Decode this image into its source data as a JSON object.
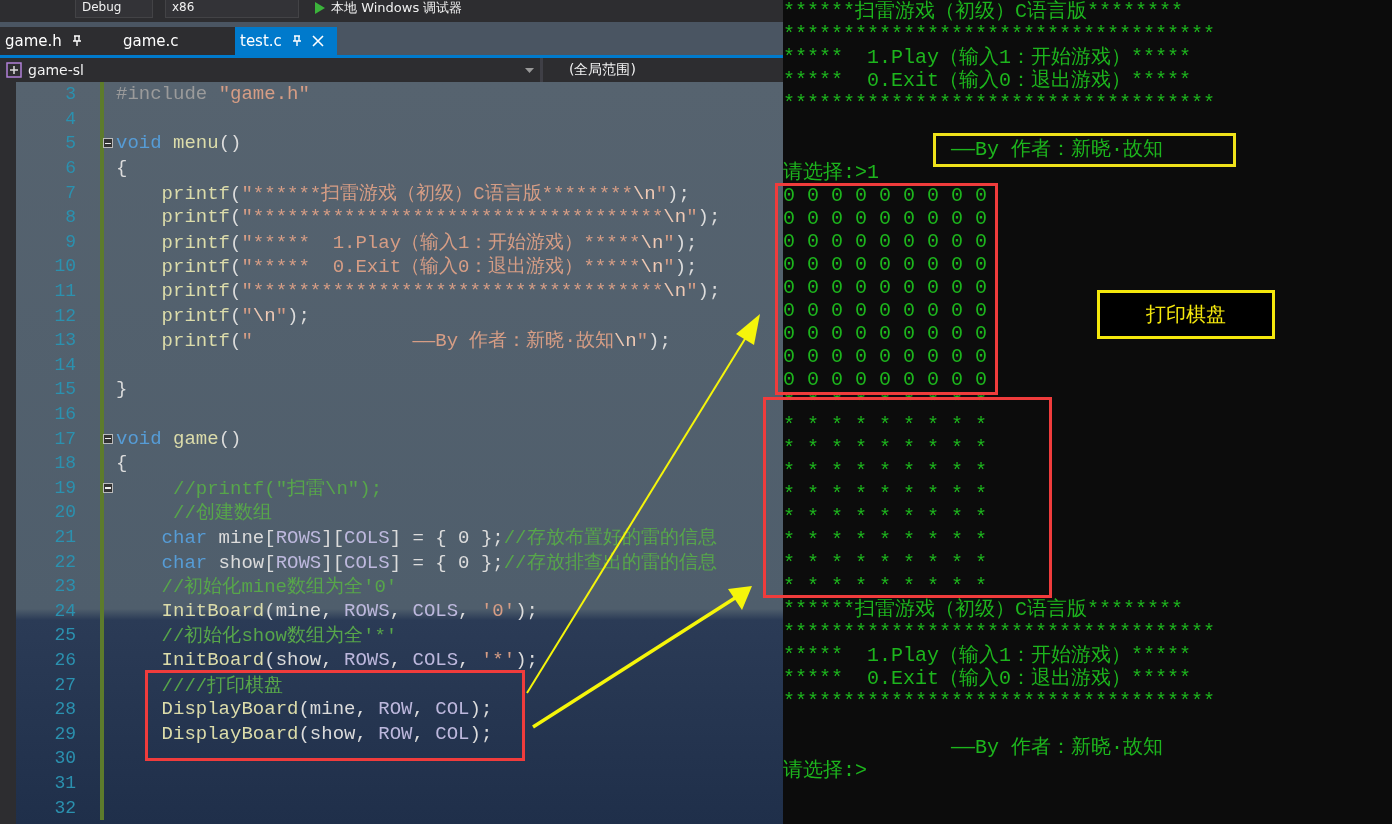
{
  "toolbar": {
    "configuration": "Debug",
    "platform": "x86",
    "debugger": "本地 Windows 调试器"
  },
  "tabs": [
    {
      "label": "game.h",
      "selected": false,
      "pinned": true
    },
    {
      "label": "game.c",
      "selected": false,
      "pinned": false
    },
    {
      "label": "test.c",
      "selected": true,
      "pinned": true
    }
  ],
  "navigation": {
    "project": "game-sl",
    "scope": "(全局范围)"
  },
  "code_lines": [
    {
      "number": "3",
      "fold": false,
      "tokens": [
        {
          "text": "#include ",
          "kind": "pre"
        },
        {
          "text": "\"game.h\"",
          "kind": "str"
        }
      ]
    },
    {
      "number": "4",
      "fold": false
    },
    {
      "number": "5",
      "fold": true,
      "tokens": [
        {
          "text": "void",
          "kind": "kw"
        },
        {
          "text": " menu",
          "kind": "fn"
        },
        {
          "text": "()",
          "kind": "plain"
        }
      ]
    },
    {
      "number": "6",
      "fold": false,
      "tokens": [
        {
          "text": "{",
          "kind": "plain"
        }
      ]
    },
    {
      "number": "7",
      "fold": false,
      "tokens": [
        {
          "text": "    printf",
          "kind": "fn"
        },
        {
          "text": "(",
          "kind": "plain"
        },
        {
          "text": "\"******扫雷游戏（初级）C语言版********",
          "kind": "str"
        },
        {
          "text": "\\n",
          "kind": "esc"
        },
        {
          "text": "\"",
          "kind": "str"
        },
        {
          "text": ");",
          "kind": "plain"
        }
      ]
    },
    {
      "number": "8",
      "fold": false,
      "tokens": [
        {
          "text": "    printf",
          "kind": "fn"
        },
        {
          "text": "(",
          "kind": "plain"
        },
        {
          "text": "\"************************************",
          "kind": "str"
        },
        {
          "text": "\\n",
          "kind": "esc"
        },
        {
          "text": "\"",
          "kind": "str"
        },
        {
          "text": ");",
          "kind": "plain"
        }
      ]
    },
    {
      "number": "9",
      "fold": false,
      "tokens": [
        {
          "text": "    printf",
          "kind": "fn"
        },
        {
          "text": "(",
          "kind": "plain"
        },
        {
          "text": "\"*****  1.Play（输入1：开始游戏）*****",
          "kind": "str"
        },
        {
          "text": "\\n",
          "kind": "esc"
        },
        {
          "text": "\"",
          "kind": "str"
        },
        {
          "text": ");",
          "kind": "plain"
        }
      ]
    },
    {
      "number": "10",
      "fold": false,
      "tokens": [
        {
          "text": "    printf",
          "kind": "fn"
        },
        {
          "text": "(",
          "kind": "plain"
        },
        {
          "text": "\"*****  0.Exit（输入0：退出游戏）*****",
          "kind": "str"
        },
        {
          "text": "\\n",
          "kind": "esc"
        },
        {
          "text": "\"",
          "kind": "str"
        },
        {
          "text": ");",
          "kind": "plain"
        }
      ]
    },
    {
      "number": "11",
      "fold": false,
      "tokens": [
        {
          "text": "    printf",
          "kind": "fn"
        },
        {
          "text": "(",
          "kind": "plain"
        },
        {
          "text": "\"************************************",
          "kind": "str"
        },
        {
          "text": "\\n",
          "kind": "esc"
        },
        {
          "text": "\"",
          "kind": "str"
        },
        {
          "text": ");",
          "kind": "plain"
        }
      ]
    },
    {
      "number": "12",
      "fold": false,
      "tokens": [
        {
          "text": "    printf",
          "kind": "fn"
        },
        {
          "text": "(",
          "kind": "plain"
        },
        {
          "text": "\"",
          "kind": "str"
        },
        {
          "text": "\\n",
          "kind": "esc"
        },
        {
          "text": "\"",
          "kind": "str"
        },
        {
          "text": ");",
          "kind": "plain"
        }
      ]
    },
    {
      "number": "13",
      "fold": false,
      "tokens": [
        {
          "text": "    printf",
          "kind": "fn"
        },
        {
          "text": "(",
          "kind": "plain"
        },
        {
          "text": "\"              ——By 作者：新晓·故知",
          "kind": "str"
        },
        {
          "text": "\\n",
          "kind": "esc"
        },
        {
          "text": "\"",
          "kind": "str"
        },
        {
          "text": ");",
          "kind": "plain"
        }
      ]
    },
    {
      "number": "14",
      "fold": false
    },
    {
      "number": "15",
      "fold": false,
      "tokens": [
        {
          "text": "}",
          "kind": "plain"
        }
      ]
    },
    {
      "number": "16",
      "fold": false
    },
    {
      "number": "17",
      "fold": true,
      "tokens": [
        {
          "text": "void",
          "kind": "kw"
        },
        {
          "text": " game",
          "kind": "fn"
        },
        {
          "text": "()",
          "kind": "plain"
        }
      ]
    },
    {
      "number": "18",
      "fold": false,
      "tokens": [
        {
          "text": "{",
          "kind": "plain"
        }
      ]
    },
    {
      "number": "19",
      "fold": true,
      "tokens": [
        {
          "text": "     //printf(\"扫雷\\n\");",
          "kind": "comment"
        }
      ]
    },
    {
      "number": "20",
      "fold": false,
      "tokens": [
        {
          "text": "     //创建数组",
          "kind": "comment"
        }
      ]
    },
    {
      "number": "21",
      "fold": false,
      "tokens": [
        {
          "text": "    char",
          "kind": "kw"
        },
        {
          "text": " mine[",
          "kind": "plain"
        },
        {
          "text": "ROWS",
          "kind": "macro"
        },
        {
          "text": "][",
          "kind": "plain"
        },
        {
          "text": "COLS",
          "kind": "macro"
        },
        {
          "text": "] = { 0 };",
          "kind": "plain"
        },
        {
          "text": "//存放布置好的雷的信息",
          "kind": "comment"
        }
      ]
    },
    {
      "number": "22",
      "fold": false,
      "tokens": [
        {
          "text": "    char",
          "kind": "kw"
        },
        {
          "text": " show[",
          "kind": "plain"
        },
        {
          "text": "ROWS",
          "kind": "macro"
        },
        {
          "text": "][",
          "kind": "plain"
        },
        {
          "text": "COLS",
          "kind": "macro"
        },
        {
          "text": "] = { 0 };",
          "kind": "plain"
        },
        {
          "text": "//存放排查出的雷的信息",
          "kind": "comment"
        }
      ]
    },
    {
      "number": "23",
      "fold": false,
      "tokens": [
        {
          "text": "    //初始化mine数组为全'0'",
          "kind": "comment"
        }
      ]
    },
    {
      "number": "24",
      "fold": false,
      "tokens": [
        {
          "text": "    InitBoard",
          "kind": "fn"
        },
        {
          "text": "(mine, ",
          "kind": "plain"
        },
        {
          "text": "ROWS",
          "kind": "macro"
        },
        {
          "text": ", ",
          "kind": "plain"
        },
        {
          "text": "COLS",
          "kind": "macro"
        },
        {
          "text": ", ",
          "kind": "plain"
        },
        {
          "text": "'0'",
          "kind": "str"
        },
        {
          "text": ");",
          "kind": "plain"
        }
      ]
    },
    {
      "number": "25",
      "fold": false,
      "tokens": [
        {
          "text": "    //初始化show数组为全'*'",
          "kind": "comment"
        }
      ]
    },
    {
      "number": "26",
      "fold": false,
      "tokens": [
        {
          "text": "    InitBoard",
          "kind": "fn"
        },
        {
          "text": "(show, ",
          "kind": "plain"
        },
        {
          "text": "ROWS",
          "kind": "macro"
        },
        {
          "text": ", ",
          "kind": "plain"
        },
        {
          "text": "COLS",
          "kind": "macro"
        },
        {
          "text": ", ",
          "kind": "plain"
        },
        {
          "text": "'*'",
          "kind": "str"
        },
        {
          "text": ");",
          "kind": "plain"
        }
      ]
    },
    {
      "number": "27",
      "fold": false,
      "tokens": [
        {
          "text": "    ////打印棋盘",
          "kind": "comment"
        }
      ]
    },
    {
      "number": "28",
      "fold": false,
      "tokens": [
        {
          "text": "    DisplayBoard",
          "kind": "fn"
        },
        {
          "text": "(mine, ",
          "kind": "plain"
        },
        {
          "text": "ROW",
          "kind": "macro"
        },
        {
          "text": ", ",
          "kind": "plain"
        },
        {
          "text": "COL",
          "kind": "macro"
        },
        {
          "text": ");",
          "kind": "plain"
        }
      ]
    },
    {
      "number": "29",
      "fold": false,
      "tokens": [
        {
          "text": "    DisplayBoard",
          "kind": "fn"
        },
        {
          "text": "(show, ",
          "kind": "plain"
        },
        {
          "text": "ROW",
          "kind": "macro"
        },
        {
          "text": ", ",
          "kind": "plain"
        },
        {
          "text": "COL",
          "kind": "macro"
        },
        {
          "text": ");",
          "kind": "plain"
        }
      ]
    },
    {
      "number": "30",
      "fold": false
    },
    {
      "number": "31",
      "fold": false
    },
    {
      "number": "32",
      "fold": false
    }
  ],
  "console_lines": [
    {
      "kind": "text",
      "text": "******扫雷游戏（初级）C语言版********"
    },
    {
      "kind": "text",
      "text": "************************************"
    },
    {
      "kind": "text",
      "text": "*****  1.Play（输入1：开始游戏）*****"
    },
    {
      "kind": "text",
      "text": "*****  0.Exit（输入0：退出游戏）*****"
    },
    {
      "kind": "text",
      "text": "************************************"
    },
    {
      "kind": "blank"
    },
    {
      "kind": "credit",
      "text": "——By 作者：新晓·故知"
    },
    {
      "kind": "text",
      "text": "请选择:>1"
    },
    {
      "kind": "text",
      "text": "0 0 0 0 0 0 0 0 0"
    },
    {
      "kind": "text",
      "text": "0 0 0 0 0 0 0 0 0"
    },
    {
      "kind": "text",
      "text": "0 0 0 0 0 0 0 0 0"
    },
    {
      "kind": "text",
      "text": "0 0 0 0 0 0 0 0 0"
    },
    {
      "kind": "text",
      "text": "0 0 0 0 0 0 0 0 0"
    },
    {
      "kind": "text",
      "text": "0 0 0 0 0 0 0 0 0"
    },
    {
      "kind": "text",
      "text": "0 0 0 0 0 0 0 0 0"
    },
    {
      "kind": "text",
      "text": "0 0 0 0 0 0 0 0 0"
    },
    {
      "kind": "text",
      "text": "0 0 0 0 0 0 0 0 0"
    },
    {
      "kind": "text",
      "text": "* * * * * * * * *"
    },
    {
      "kind": "text",
      "text": "* * * * * * * * *"
    },
    {
      "kind": "text",
      "text": "* * * * * * * * *"
    },
    {
      "kind": "text",
      "text": "* * * * * * * * *"
    },
    {
      "kind": "text",
      "text": "* * * * * * * * *"
    },
    {
      "kind": "text",
      "text": "* * * * * * * * *"
    },
    {
      "kind": "text",
      "text": "* * * * * * * * *"
    },
    {
      "kind": "text",
      "text": "* * * * * * * * *"
    },
    {
      "kind": "text",
      "text": "* * * * * * * * *"
    },
    {
      "kind": "text",
      "text": "******扫雷游戏（初级）C语言版********"
    },
    {
      "kind": "text",
      "text": "************************************"
    },
    {
      "kind": "text",
      "text": "*****  1.Play（输入1：开始游戏）*****"
    },
    {
      "kind": "text",
      "text": "*****  0.Exit（输入0：退出游戏）*****"
    },
    {
      "kind": "text",
      "text": "************************************"
    },
    {
      "kind": "blank"
    },
    {
      "kind": "credit",
      "text": "——By 作者：新晓·故知"
    },
    {
      "kind": "text",
      "text": "请选择:>"
    }
  ],
  "annotation": {
    "label": "打印棋盘"
  }
}
